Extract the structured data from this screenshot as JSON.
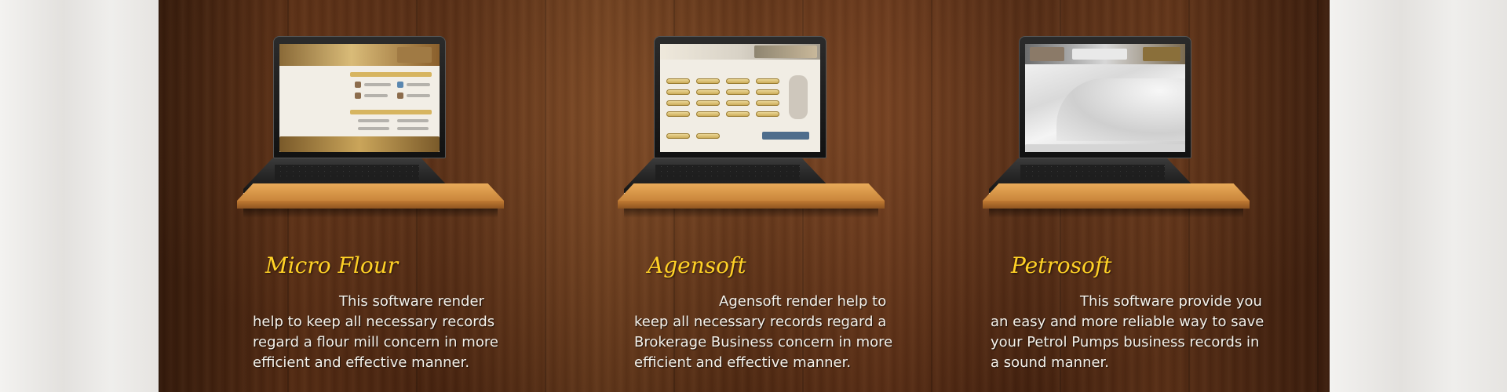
{
  "products": [
    {
      "title": "Micro Flour",
      "description": {
        "line1": "This software render",
        "line2": "help to keep all necessary records",
        "line3": "regard a flour mill concern in more",
        "line4": "efficient and effective manner."
      },
      "screen_icon": "micro-flour-app-screen"
    },
    {
      "title": "Agensoft",
      "description": {
        "line1": "Agensoft render help to",
        "line2": "keep all necessary records regard a",
        "line3": "Brokerage Business concern in more",
        "line4": "efficient and effective manner."
      },
      "screen_icon": "agensoft-app-screen"
    },
    {
      "title": "Petrosoft",
      "description": {
        "line1": "This software provide you",
        "line2": "an easy and more reliable way to save",
        "line3": "your Petrol Pumps business records in",
        "line4": "a sound manner."
      },
      "screen_icon": "petrosoft-app-screen"
    }
  ],
  "colors": {
    "title": "#ffd126",
    "description": "#f4f1ea",
    "shelf": "#d48f42",
    "wood_dark": "#4a2410",
    "wood_light": "#74401e"
  }
}
